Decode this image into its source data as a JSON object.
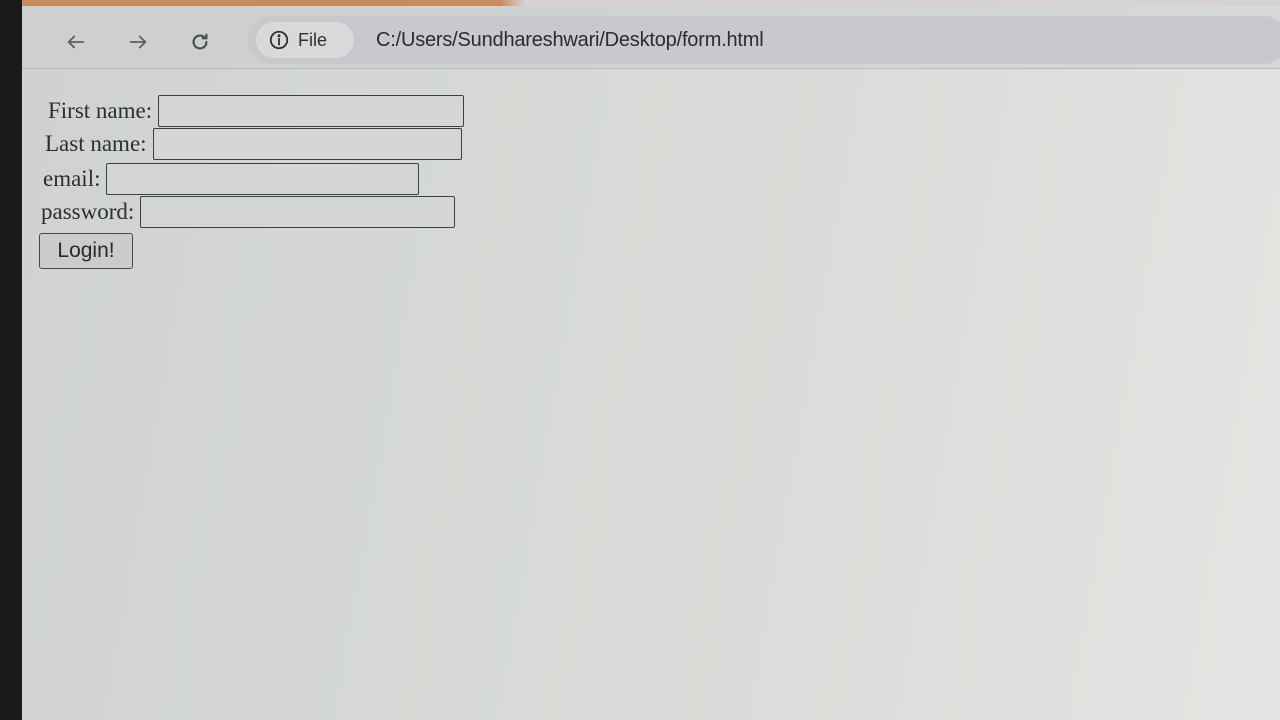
{
  "browser": {
    "nav": {
      "back_icon": "back-arrow-icon",
      "forward_icon": "forward-arrow-icon",
      "reload_icon": "reload-icon"
    },
    "omnibox": {
      "site_info_icon": "info-circle-icon",
      "site_label": "File",
      "url": "C:/Users/Sundhareshwari/Desktop/form.html"
    }
  },
  "form": {
    "first_name_label": "First name:",
    "first_name_value": "",
    "last_name_label": "Last name:",
    "last_name_value": "",
    "email_label": "email:",
    "email_value": "",
    "password_label": "password:",
    "password_value": "",
    "submit_label": "Login!"
  }
}
